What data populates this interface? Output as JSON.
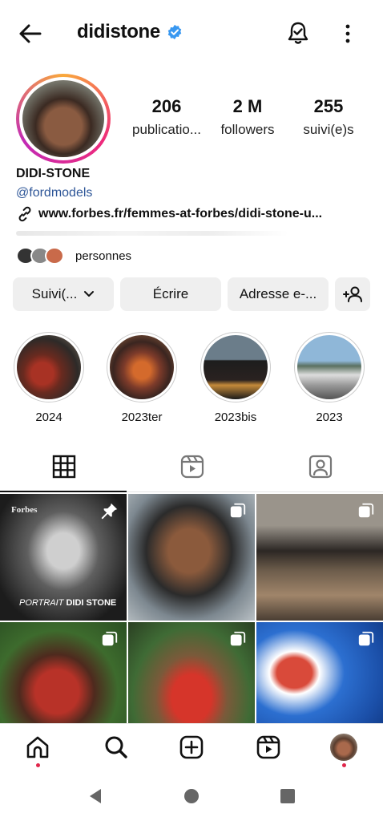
{
  "header": {
    "username": "didistone",
    "verified": true,
    "icons": {
      "back": "back-arrow-icon",
      "bell": "notification-bell-icon",
      "more": "more-vertical-icon"
    }
  },
  "stats": [
    {
      "num": "206",
      "label": "publicatio..."
    },
    {
      "num": "2 M",
      "label": "followers"
    },
    {
      "num": "255",
      "label": "suivi(e)s"
    }
  ],
  "bio": {
    "name": "DIDI-STONE",
    "handle": "@fordmodels",
    "link": "www.forbes.fr/femmes-at-forbes/didi-stone-u...",
    "mutual_text": "personnes"
  },
  "buttons": {
    "follow": "Suivi(...",
    "message": "Écrire",
    "email": "Adresse e-..."
  },
  "highlights": [
    {
      "label": "2024"
    },
    {
      "label": "2023ter"
    },
    {
      "label": "2023bis"
    },
    {
      "label": "2023"
    }
  ],
  "posts": {
    "first_post": {
      "brand": "Forbes",
      "caption_italic": "PORTRAIT",
      "caption_bold": " DIDI STONE",
      "pinned": true
    }
  },
  "colors": {
    "link": "#2d5597",
    "verified": "#3897f0",
    "notification_dot": "#e0264b",
    "button_bg": "#efefef"
  }
}
